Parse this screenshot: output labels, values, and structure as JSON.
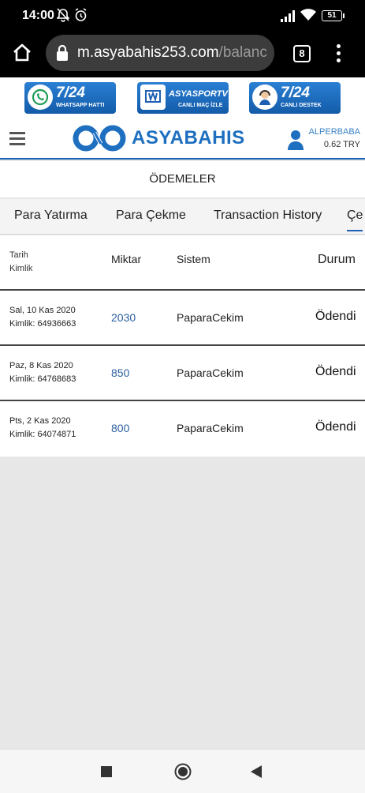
{
  "status_bar": {
    "time": "14:00",
    "battery": "51"
  },
  "browser": {
    "url_host": "m.asyabahis253.com",
    "url_path": "/balanc",
    "tab_count": "8"
  },
  "top_banners": [
    {
      "main": "7/24",
      "sub": "WHATSAPP HATTI"
    },
    {
      "main": "ASYASPORTV",
      "sub": "CANLI MAÇ İZLE"
    },
    {
      "main": "7/24",
      "sub": "CANLI DESTEK"
    }
  ],
  "header": {
    "logo_text": "ASYABAHIS",
    "username": "ALPERBABA",
    "balance": "0.62 TRY"
  },
  "section_title": "ÖDEMELER",
  "tabs": [
    {
      "label": "Para Yatırma"
    },
    {
      "label": "Para Çekme"
    },
    {
      "label": "Transaction History"
    },
    {
      "label": "Çe"
    }
  ],
  "table": {
    "headers": {
      "date": "Tarih",
      "id": "Kimlik",
      "amount": "Miktar",
      "system": "Sistem",
      "status": "Durum"
    },
    "rows": [
      {
        "date": "Sal, 10 Kas 2020",
        "kimlik": "Kimlik: 64936663",
        "amount": "2030",
        "system": "PaparaCekim",
        "status": "Ödendi"
      },
      {
        "date": "Paz, 8 Kas 2020",
        "kimlik": "Kimlik: 64768683",
        "amount": "850",
        "system": "PaparaCekim",
        "status": "Ödendi"
      },
      {
        "date": "Pts, 2 Kas 2020",
        "kimlik": "Kimlik: 64074871",
        "amount": "800",
        "system": "PaparaCekim",
        "status": "Ödendi"
      }
    ]
  },
  "colors": {
    "brand_blue": "#1e6fc0",
    "amount_blue": "#2a5f9e"
  }
}
